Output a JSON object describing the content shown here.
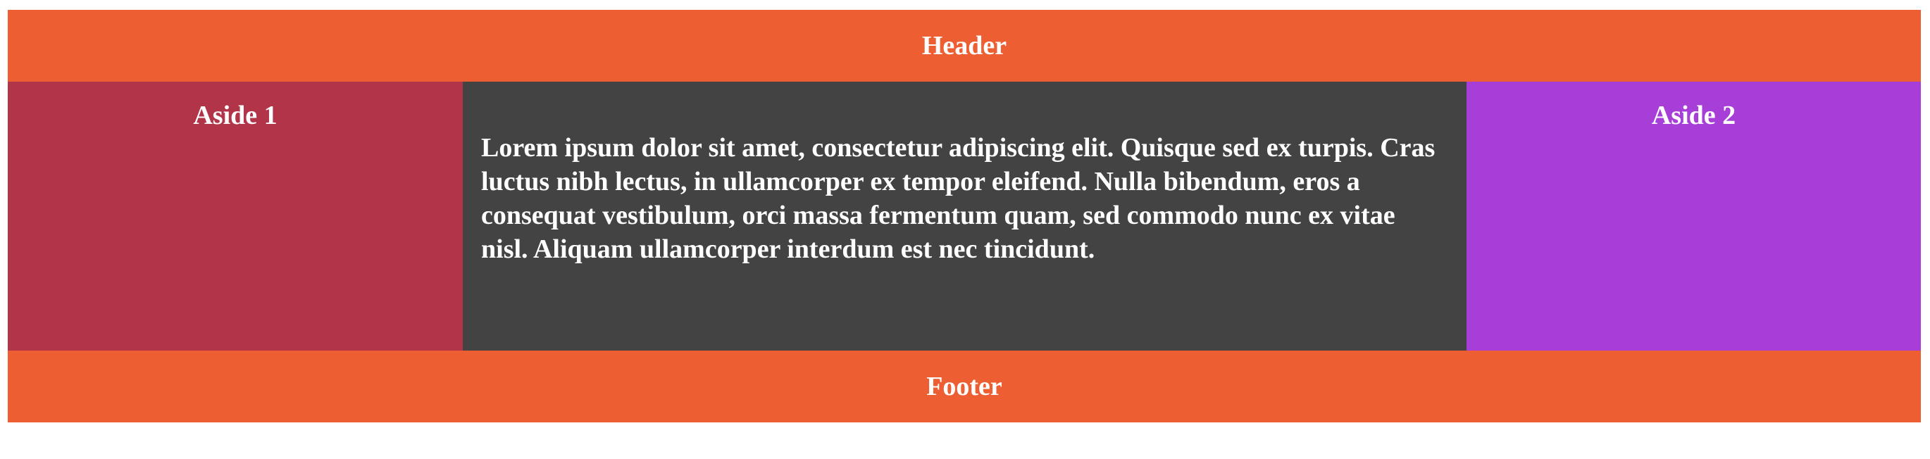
{
  "header": {
    "title": "Header"
  },
  "aside1": {
    "title": "Aside 1"
  },
  "main": {
    "text": "Lorem ipsum dolor sit amet, consectetur adipiscing elit. Quisque sed ex turpis. Cras luctus nibh lectus, in ullamcorper ex tempor eleifend. Nulla bibendum, eros a consequat vestibulum, orci massa fermentum quam, sed commodo nunc ex vitae nisl. Aliquam ullamcorper interdum est nec tincidunt."
  },
  "aside2": {
    "title": "Aside 2"
  },
  "footer": {
    "title": "Footer"
  },
  "colors": {
    "header": "#ed5f32",
    "aside1": "#b23448",
    "main": "#434343",
    "aside2": "#a73ed8",
    "footer": "#ed5f32",
    "text": "#ffffff"
  }
}
